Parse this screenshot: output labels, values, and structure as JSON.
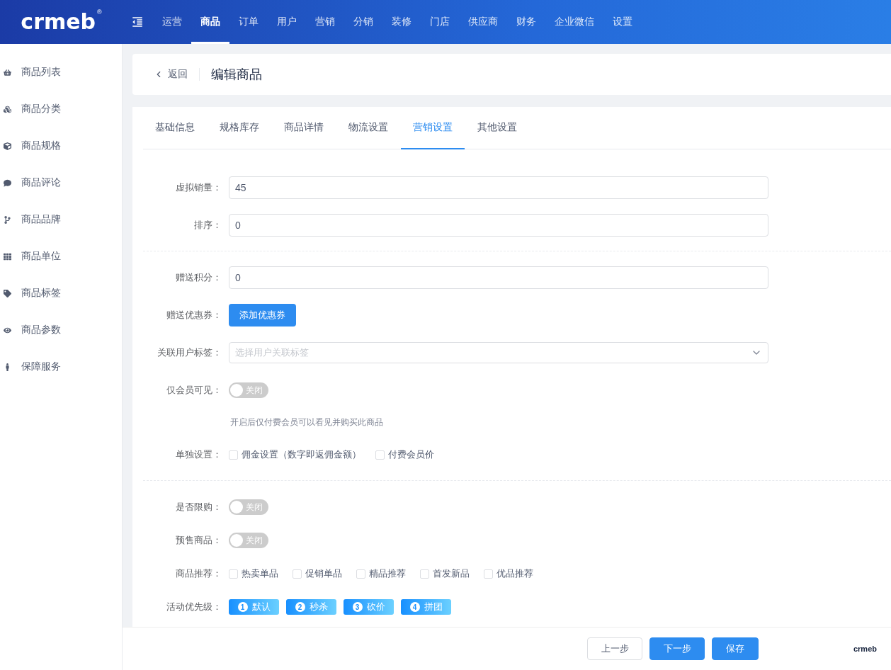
{
  "header": {
    "logo": "crmeb",
    "logo_mark": "®",
    "nav": [
      {
        "label": "运营",
        "selected": false
      },
      {
        "label": "商品",
        "selected": true
      },
      {
        "label": "订单",
        "selected": false
      },
      {
        "label": "用户",
        "selected": false
      },
      {
        "label": "营销",
        "selected": false
      },
      {
        "label": "分销",
        "selected": false
      },
      {
        "label": "装修",
        "selected": false
      },
      {
        "label": "门店",
        "selected": false
      },
      {
        "label": "供应商",
        "selected": false
      },
      {
        "label": "财务",
        "selected": false
      },
      {
        "label": "企业微信",
        "selected": false
      },
      {
        "label": "设置",
        "selected": false
      }
    ]
  },
  "sidebar": {
    "items": [
      {
        "label": "商品列表"
      },
      {
        "label": "商品分类"
      },
      {
        "label": "商品规格"
      },
      {
        "label": "商品评论"
      },
      {
        "label": "商品品牌"
      },
      {
        "label": "商品单位"
      },
      {
        "label": "商品标签"
      },
      {
        "label": "商品参数"
      },
      {
        "label": "保障服务"
      }
    ]
  },
  "page_header": {
    "back": "返回",
    "title": "编辑商品"
  },
  "tabs": [
    {
      "label": "基础信息",
      "selected": false
    },
    {
      "label": "规格库存",
      "selected": false
    },
    {
      "label": "商品详情",
      "selected": false
    },
    {
      "label": "物流设置",
      "selected": false
    },
    {
      "label": "营销设置",
      "selected": true
    },
    {
      "label": "其他设置",
      "selected": false
    }
  ],
  "form": {
    "sections": [
      [
        {
          "kind": "input",
          "label": "虚拟销量：",
          "value": "45"
        },
        {
          "kind": "input",
          "label": "排序：",
          "value": "0"
        }
      ],
      [
        {
          "kind": "input",
          "label": "赠送积分：",
          "value": "0"
        },
        {
          "kind": "button",
          "label": "赠送优惠券：",
          "button": "添加优惠券"
        },
        {
          "kind": "select",
          "label": "关联用户标签：",
          "placeholder": "选择用户关联标签"
        },
        {
          "kind": "switch",
          "label": "仅会员可见：",
          "on": false,
          "text": "关闭"
        },
        {
          "kind": "hint",
          "text": "开启后仅付费会员可以看见并购买此商品"
        },
        {
          "kind": "checkboxes",
          "label": "单独设置：",
          "options": [
            {
              "label": "佣金设置（数字即返佣金额）",
              "checked": false
            },
            {
              "label": "付费会员价",
              "checked": false
            }
          ]
        }
      ],
      [
        {
          "kind": "switch",
          "label": "是否限购：",
          "on": false,
          "text": "关闭"
        },
        {
          "kind": "switch",
          "label": "预售商品：",
          "on": false,
          "text": "关闭"
        },
        {
          "kind": "checkboxes",
          "label": "商品推荐：",
          "options": [
            {
              "label": "热卖单品",
              "checked": false
            },
            {
              "label": "促销单品",
              "checked": false
            },
            {
              "label": "精品推荐",
              "checked": false
            },
            {
              "label": "首发新品",
              "checked": false
            },
            {
              "label": "优品推荐",
              "checked": false
            }
          ]
        },
        {
          "kind": "priority",
          "label": "活动优先级：",
          "items": [
            {
              "number": "1",
              "label": "默认"
            },
            {
              "number": "2",
              "label": "秒杀"
            },
            {
              "number": "3",
              "label": "砍价"
            },
            {
              "number": "4",
              "label": "拼团"
            }
          ]
        }
      ]
    ]
  },
  "footer": {
    "buttons": [
      {
        "label": "上一步",
        "kind": "plain"
      },
      {
        "label": "下一步",
        "kind": "primary"
      },
      {
        "label": "保存",
        "kind": "primary"
      }
    ],
    "logo": "crmeb"
  }
}
